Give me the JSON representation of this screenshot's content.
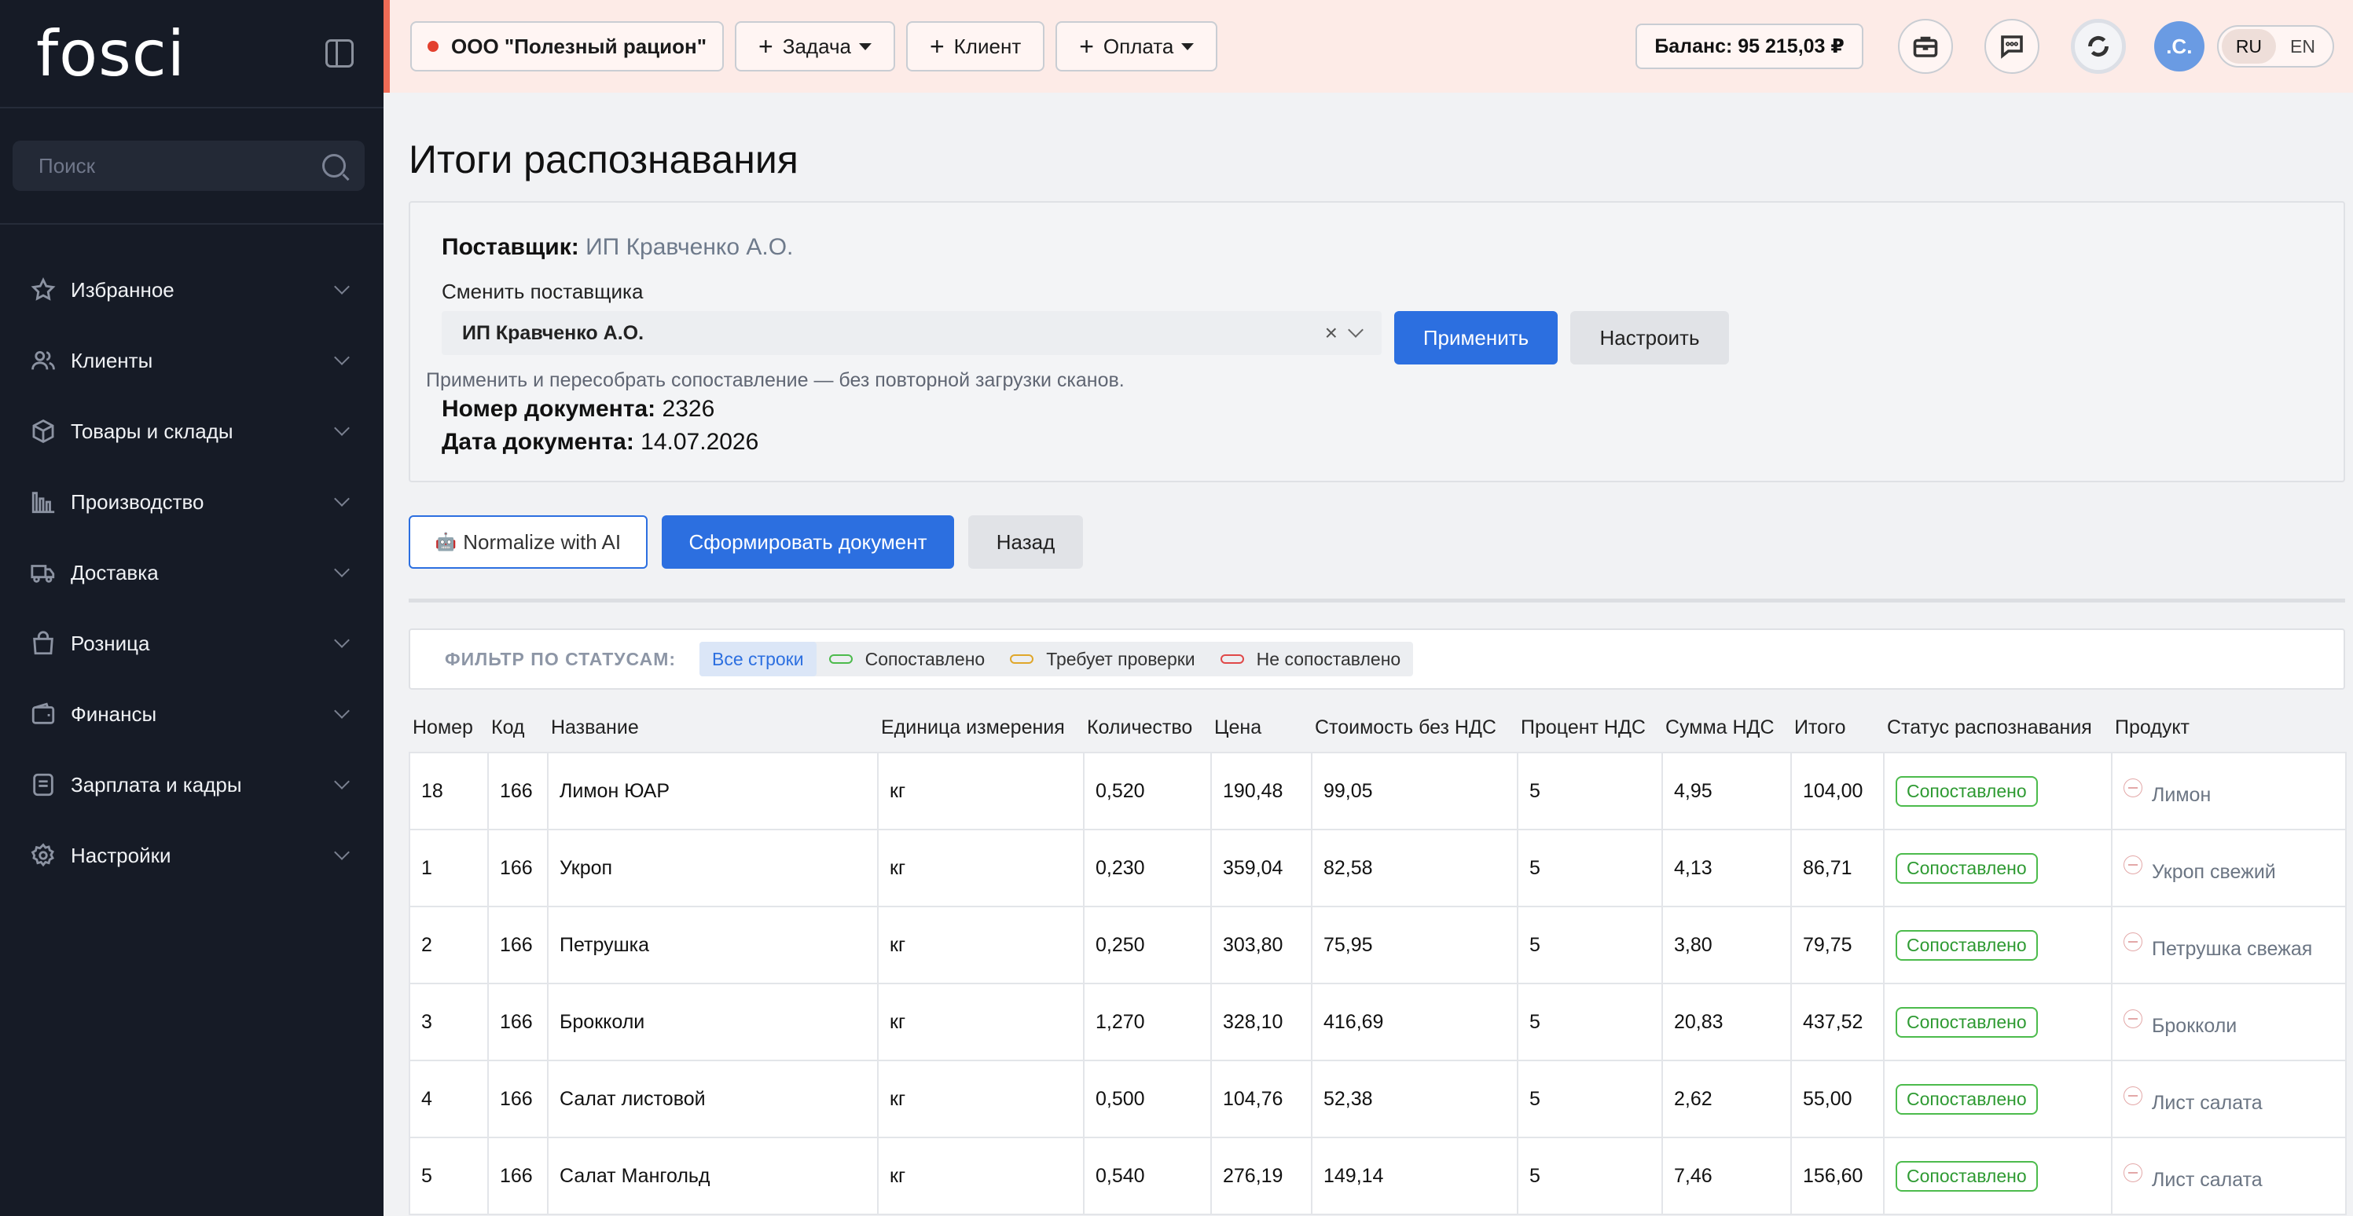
{
  "sidebar": {
    "logo": "fosci",
    "search_placeholder": "Поиск",
    "items": [
      {
        "label": "Избранное",
        "icon": "star-icon"
      },
      {
        "label": "Клиенты",
        "icon": "users-icon"
      },
      {
        "label": "Товары и склады",
        "icon": "box-icon"
      },
      {
        "label": "Производство",
        "icon": "factory-icon"
      },
      {
        "label": "Доставка",
        "icon": "truck-icon"
      },
      {
        "label": "Розница",
        "icon": "bag-icon"
      },
      {
        "label": "Финансы",
        "icon": "wallet-icon"
      },
      {
        "label": "Зарплата и кадры",
        "icon": "document-icon"
      },
      {
        "label": "Настройки",
        "icon": "gear-icon"
      }
    ]
  },
  "topbar": {
    "org": "ООО \"Полезный рацион\"",
    "task": "Задача",
    "client": "Клиент",
    "payment": "Оплата",
    "balance": "Баланс: 95 215,03 ₽",
    "avatar": ".C.",
    "lang_ru": "RU",
    "lang_en": "EN",
    "accent": "#ee6b55"
  },
  "page": {
    "title": "Итоги распознавания",
    "supplier_label": "Поставщик:",
    "supplier_value": "ИП Кравченко А.О.",
    "change_label": "Сменить поставщика",
    "select_value": "ИП Кравченко А.О.",
    "apply": "Применить",
    "setup": "Настроить",
    "hint": "Применить и пересобрать сопоставление — без повторной загрузки сканов.",
    "docnum_label": "Номер документа:",
    "docnum_value": "2326",
    "docdate_label": "Дата документа:",
    "docdate_value": "14.07.2026"
  },
  "actions": {
    "ai": "Normalize with AI",
    "form": "Сформировать документ",
    "back": "Назад"
  },
  "filter": {
    "label": "ФИЛЬТР ПО СТАТУСАМ:",
    "all": "Все строки",
    "matched": "Сопоставлено",
    "review": "Требует проверки",
    "unmatched": "Не сопоставлено"
  },
  "table": {
    "headers": [
      "Номер",
      "Код",
      "Название",
      "Единица измерения",
      "Количество",
      "Цена",
      "Стоимость без НДС",
      "Процент НДС",
      "Сумма НДС",
      "Итого",
      "Статус распознавания",
      "Продукт"
    ],
    "rows": [
      [
        "18",
        "166",
        "Лимон ЮАР",
        "кг",
        "0,520",
        "190,48",
        "99,05",
        "5",
        "4,95",
        "104,00",
        "Сопоставлено",
        "Лимон"
      ],
      [
        "1",
        "166",
        "Укроп",
        "кг",
        "0,230",
        "359,04",
        "82,58",
        "5",
        "4,13",
        "86,71",
        "Сопоставлено",
        "Укроп свежий"
      ],
      [
        "2",
        "166",
        "Петрушка",
        "кг",
        "0,250",
        "303,80",
        "75,95",
        "5",
        "3,80",
        "79,75",
        "Сопоставлено",
        "Петрушка свежая"
      ],
      [
        "3",
        "166",
        "Брокколи",
        "кг",
        "1,270",
        "328,10",
        "416,69",
        "5",
        "20,83",
        "437,52",
        "Сопоставлено",
        "Брокколи"
      ],
      [
        "4",
        "166",
        "Салат листовой",
        "кг",
        "0,500",
        "104,76",
        "52,38",
        "5",
        "2,62",
        "55,00",
        "Сопоставлено",
        "Лист салата"
      ],
      [
        "5",
        "166",
        "Салат Мангольд",
        "кг",
        "0,540",
        "276,19",
        "149,14",
        "5",
        "7,46",
        "156,60",
        "Сопоставлено",
        "Лист салата"
      ]
    ]
  }
}
